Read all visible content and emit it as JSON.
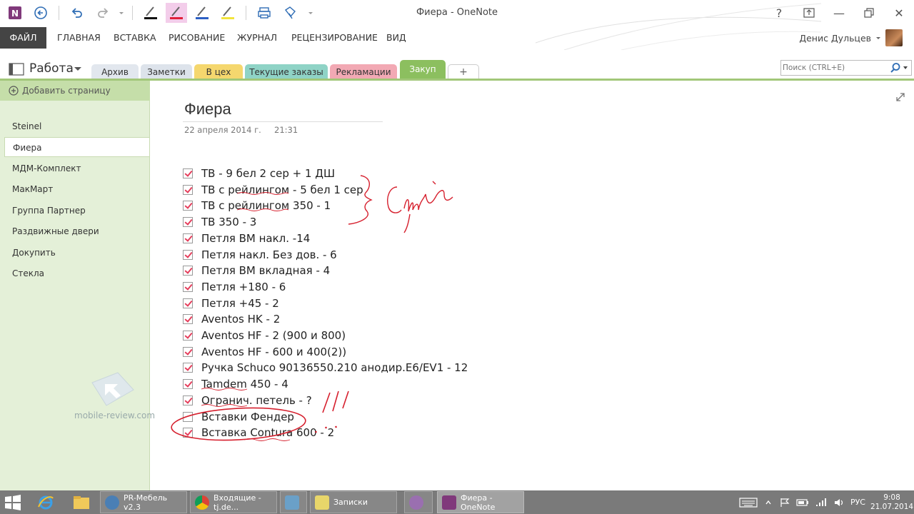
{
  "window": {
    "title": "Фиера - OneNote",
    "help": "?",
    "minimize": "—",
    "close": "✕"
  },
  "ribbon": {
    "tabs": [
      "ФАЙЛ",
      "ГЛАВНАЯ",
      "ВСТАВКА",
      "РИСОВАНИЕ",
      "ЖУРНАЛ",
      "РЕЦЕНЗИРОВАНИЕ",
      "ВИД"
    ]
  },
  "user": {
    "name": "Денис Дульцев"
  },
  "notebook": {
    "name": "Работа",
    "sections": [
      {
        "label": "Архив",
        "color": "#e2e7ee"
      },
      {
        "label": "Заметки",
        "color": "#dde3eb"
      },
      {
        "label": "В цех",
        "color": "#f5d76e"
      },
      {
        "label": "Текущие заказы",
        "color": "#8fd3c6"
      },
      {
        "label": "Рекламации",
        "color": "#f2a9b4"
      },
      {
        "label": "Закуп",
        "color": "#8cbf5f"
      }
    ],
    "add_section": "+"
  },
  "search": {
    "placeholder": "Поиск (CTRL+E)"
  },
  "sidebar": {
    "add_page": "Добавить страницу",
    "pages": [
      "Steinel",
      "Фиера",
      "МДМ-Комплект",
      "МакМарт",
      "Группа Партнер",
      "Раздвижные двери",
      "Докупить",
      "Стекла"
    ],
    "watermark": "mobile-review.com"
  },
  "page": {
    "title": "Фиера",
    "date": "22 апреля 2014 г.",
    "time": "21:31",
    "todos": [
      {
        "text": "ТВ - 9 бел 2 сер + 1 ДШ",
        "checked": true
      },
      {
        "text": "ТВ с рейлингом - 5 бел 1 сер",
        "checked": true
      },
      {
        "text": "ТВ с рейлингом 350 - 1",
        "checked": true
      },
      {
        "text": "ТВ 350 - 3",
        "checked": true
      },
      {
        "text": "Петля ВМ накл. -14",
        "checked": true
      },
      {
        "text": "Петля накл. Без дов.   - 6",
        "checked": true
      },
      {
        "text": "Петля ВМ вкладная - 4",
        "checked": true
      },
      {
        "text": "Петля +180 - 6",
        "checked": true
      },
      {
        "text": "Петля +45 - 2",
        "checked": true
      },
      {
        "text": "Aventos HK - 2",
        "checked": true
      },
      {
        "text": "Aventos HF - 2 (900 и 800)",
        "checked": true
      },
      {
        "text": "Aventos HF - 600 и 400(2))",
        "checked": true
      },
      {
        "text": "Ручка Schuco 90136550.210 анодир.Е6/EV1 - 12",
        "checked": true
      },
      {
        "text": "Tamdem 450 - 4",
        "checked": true
      },
      {
        "text": "Огранич. петель - ?",
        "checked": true
      },
      {
        "text": "Вставки Фендер",
        "checked": false
      },
      {
        "text": "Вставка Contura 600 - 2",
        "checked": true
      }
    ]
  },
  "taskbar": {
    "items": [
      {
        "label": "PR-Мебель v2.3",
        "color": "#4a7fb5"
      },
      {
        "label": "Входящие - tj.de...",
        "color": "#d9a03a"
      },
      {
        "label": "",
        "color": "#6aa0c8"
      },
      {
        "label": "Записки",
        "color": "#e8d66a"
      },
      {
        "label": "",
        "color": "#9a6fb0"
      },
      {
        "label": "Фиера - OneNote",
        "color": "#80397b"
      }
    ],
    "lang": "РУС",
    "time": "9:08",
    "date": "21.07.2014"
  },
  "colors": {
    "accent_onenote": "#80397b",
    "sidebar_bg": "#e4f0d8",
    "ink_red": "#d6202e"
  }
}
